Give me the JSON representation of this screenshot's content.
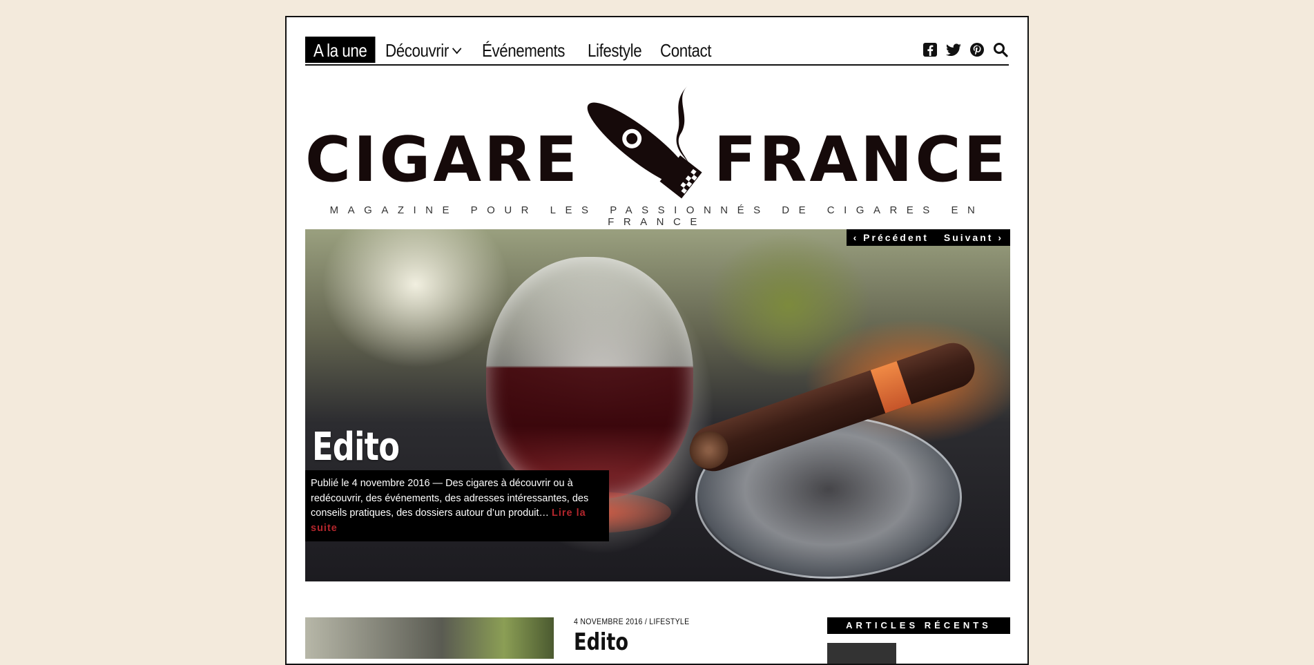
{
  "nav": {
    "items": [
      {
        "label": "A la une",
        "active": true
      },
      {
        "label": "Découvrir",
        "has_dropdown": true
      },
      {
        "label": "Événements"
      },
      {
        "label": "Lifestyle"
      },
      {
        "label": "Contact"
      }
    ],
    "icons": [
      "facebook-icon",
      "twitter-icon",
      "pinterest-icon",
      "search-icon"
    ]
  },
  "logo": {
    "left": "CIGARE",
    "right": "FRANCE",
    "tagline": "MAGAZINE POUR LES PASSIONNÉS DE CIGARES EN FRANCE"
  },
  "slider": {
    "prev_label": "Précédent",
    "next_label": "Suivant",
    "title": "Edito",
    "excerpt": "Publié le 4 novembre 2016  —  Des cigares à découvrir ou à redécouvrir, des événements, des adresses intéressantes, des conseils pratiques, des dossiers autour d’un produit…",
    "more_label": "Lire la suite"
  },
  "post": {
    "date": "4 NOVEMBRE 2016",
    "separator": "/",
    "category": "LIFESTYLE",
    "title": "Edito"
  },
  "sidebar": {
    "widget_title": "ARTICLES RÉCENTS"
  },
  "colors": {
    "background": "#f3eadc",
    "link_accent": "#b3262c",
    "logo": "#160a0a"
  }
}
